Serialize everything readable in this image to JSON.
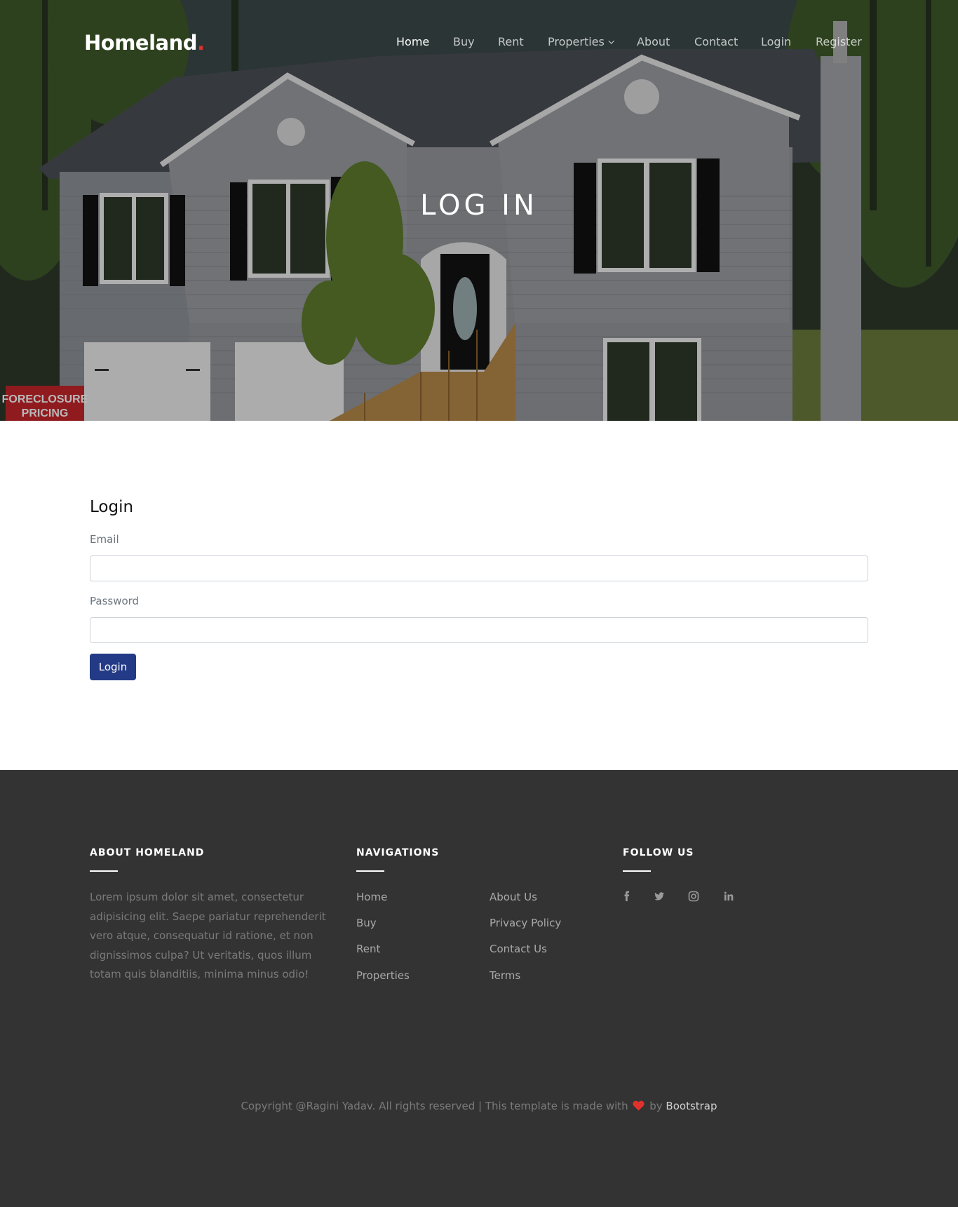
{
  "brand": {
    "name": "Homeland",
    "dot": ".",
    "accent_color": "#e0312c"
  },
  "nav": {
    "items": [
      {
        "label": "Home",
        "active": true
      },
      {
        "label": "Buy"
      },
      {
        "label": "Rent"
      },
      {
        "label": "Properties",
        "has_dropdown": true
      },
      {
        "label": "About"
      },
      {
        "label": "Contact"
      },
      {
        "label": "Login"
      },
      {
        "label": "Register"
      }
    ]
  },
  "hero": {
    "title": "LOG IN",
    "sign_line1": "FORECLOSURE",
    "sign_line2": "PRICING"
  },
  "login": {
    "heading": "Login",
    "email_label": "Email",
    "email_value": "",
    "password_label": "Password",
    "password_value": "",
    "button_label": "Login",
    "button_color": "#233a86"
  },
  "footer": {
    "about": {
      "heading": "ABOUT HOMELAND",
      "text": "Lorem ipsum dolor sit amet, consectetur adipisicing elit. Saepe pariatur reprehenderit vero atque, consequatur id ratione, et non dignissimos culpa? Ut veritatis, quos illum totam quis blanditiis, minima minus odio!"
    },
    "navigations": {
      "heading": "NAVIGATIONS",
      "col1": [
        "Home",
        "Buy",
        "Rent",
        "Properties"
      ],
      "col2": [
        "About Us",
        "Privacy Policy",
        "Contact Us",
        "Terms"
      ]
    },
    "follow": {
      "heading": "FOLLOW US",
      "icons": [
        "facebook-icon",
        "twitter-icon",
        "instagram-icon",
        "linkedin-icon"
      ]
    },
    "copyright": {
      "prefix": "Copyright @Ragini Yadav. All rights reserved | This template is made with",
      "by": "by",
      "link": "Bootstrap",
      "heart_color": "#e0312c"
    },
    "background": "#333333"
  }
}
